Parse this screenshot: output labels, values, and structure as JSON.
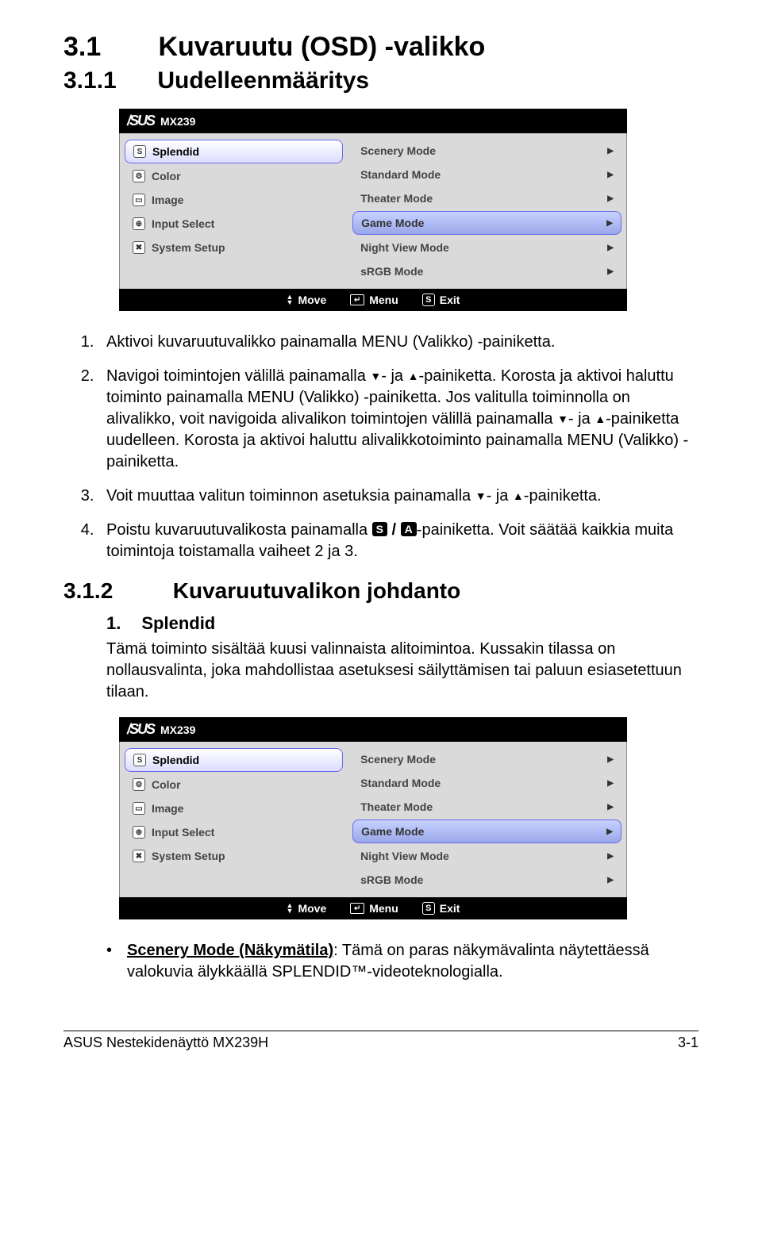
{
  "heading1": {
    "num": "3.1",
    "text": "Kuvaruutu (OSD) -valikko"
  },
  "heading1b": {
    "num": "3.1.1",
    "text": "Uudelleenmääritys"
  },
  "osd": {
    "brand": "/SUS",
    "model": "MX239",
    "left": [
      {
        "icon": "S",
        "label": "Splendid",
        "selected": true
      },
      {
        "icon": "⚙",
        "label": "Color"
      },
      {
        "icon": "▭",
        "label": "Image"
      },
      {
        "icon": "⊕",
        "label": "Input Select"
      },
      {
        "icon": "✖",
        "label": "System Setup"
      }
    ],
    "right": [
      {
        "label": "Scenery Mode"
      },
      {
        "label": "Standard Mode"
      },
      {
        "label": "Theater Mode"
      },
      {
        "label": "Game Mode",
        "selected": true
      },
      {
        "label": "Night View Mode"
      },
      {
        "label": "sRGB Mode"
      }
    ],
    "footer": {
      "move": "Move",
      "menu": "Menu",
      "exit": "Exit"
    }
  },
  "steps": {
    "s1": "Aktivoi kuvaruutuvalikko painamalla MENU (Valikko) -painiketta.",
    "s2a": "Navigoi toimintojen välillä painamalla ",
    "s2b": "- ja ",
    "s2c": "-painiketta. Korosta ja aktivoi haluttu toiminto painamalla MENU (Valikko) -painiketta. Jos valitulla toiminnolla on alivalikko, voit navigoida alivalikon toimintojen välillä painamalla ",
    "s2d": "- ja ",
    "s2e": "-painiketta uudelleen. Korosta ja aktivoi haluttu alivalikkotoiminto painamalla MENU (Valikko) -painiketta.",
    "s3a": "Voit muuttaa valitun toiminnon asetuksia painamalla ",
    "s3b": "- ja ",
    "s3c": "-painiketta.",
    "s4a": "Poistu kuvaruutuvalikosta painamalla ",
    "s4b": "-painiketta. Voit säätää kaikkia muita toimintoja toistamalla vaiheet 2 ja 3."
  },
  "section312": {
    "num": "3.1.2",
    "text": "Kuvaruutuvalikon johdanto"
  },
  "splendid": {
    "num": "1.",
    "title": "Splendid"
  },
  "splendid_para": "Tämä toiminto sisältää kuusi valinnaista alitoimintoa. Kussakin tilassa on nollausvalinta, joka mahdollistaa asetuksesi säilyttämisen tai paluun esiasetettuun tilaan.",
  "bullet": {
    "title": "Scenery Mode (Näkymätila)",
    "rest": ": Tämä on paras näkymävalinta näytettäessä valokuvia älykkäällä SPLENDID™-videoteknologialla."
  },
  "footer": {
    "left": "ASUS Nestekidenäyttö MX239H",
    "right": "3-1"
  }
}
